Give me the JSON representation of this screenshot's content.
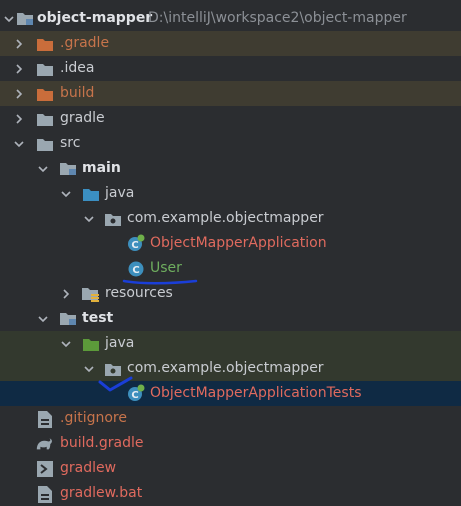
{
  "project": {
    "name": "object-mapper",
    "path": "D:\\intelliJ\\workspace2\\object-mapper"
  },
  "tree": {
    "gradle_hidden": ".gradle",
    "idea": ".idea",
    "build": "build",
    "gradle": "gradle",
    "src": "src",
    "main": "main",
    "main_java": "java",
    "main_package": "com.example.objectmapper",
    "app_class": "ObjectMapperApplication",
    "user_class": "User",
    "resources": "resources",
    "test": "test",
    "test_java": "java",
    "test_package": "com.example.objectmapper",
    "test_class": "ObjectMapperApplicationTests",
    "gitignore": ".gitignore",
    "build_gradle": "build.gradle",
    "gradlew": "gradlew",
    "gradlew_bat": "gradlew.bat"
  },
  "colors": {
    "background": "#2b2d30",
    "excluded_row": "#3f3c31",
    "test_row": "#33392e",
    "selected_row": "#0f2a44",
    "modified_text": "#e06a5e",
    "added_text": "#6fae5f",
    "excluded_text": "#c7744b",
    "annotation": "#1a3ed8"
  },
  "icons": {
    "project": "module-folder-icon",
    "excluded": "excluded-folder-icon",
    "folder": "folder-icon",
    "source_root": "source-folder-icon",
    "test_root": "test-source-folder-icon",
    "package": "package-icon",
    "class": "java-class-icon",
    "spring_class": "spring-boot-class-icon",
    "resources": "resources-folder-icon",
    "file": "text-file-icon",
    "gradle_file": "gradle-file-icon",
    "script": "shell-script-icon",
    "bat": "batch-file-icon"
  },
  "selected_item": "ObjectMapperApplicationTests"
}
